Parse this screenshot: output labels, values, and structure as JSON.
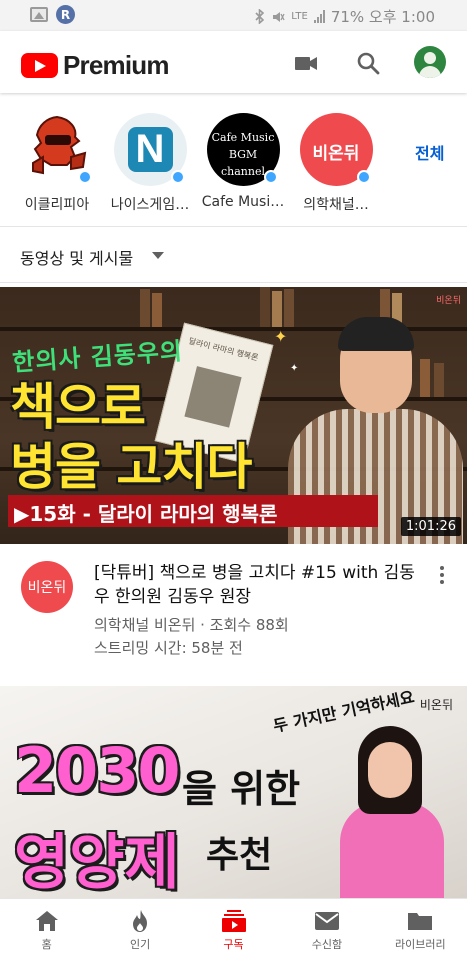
{
  "status_bar": {
    "right_text": "71% 오후 1:00",
    "network": "LTE"
  },
  "header": {
    "logo_text": "Premium"
  },
  "channels": {
    "items": [
      {
        "name": "이클리피아",
        "avatar_bg": "#ffffff"
      },
      {
        "name": "나이스게임…",
        "avatar_bg": "#e9f0f3",
        "avatar_letter": "N"
      },
      {
        "name": "Cafe Musi…",
        "avatar_bg": "#000000",
        "avatar_text": "Cafe Music BGM channel"
      },
      {
        "name": "의학채널…",
        "avatar_bg": "#ef4a4e",
        "avatar_text": "비온뒤"
      }
    ],
    "all_label": "전체"
  },
  "filter": {
    "label": "동영상 및 게시물"
  },
  "videos": [
    {
      "thumb_subtitle": "한의사 김동우의",
      "thumb_line1": "책으로",
      "thumb_line2": "병을 고치다",
      "thumb_bar": "▶15화 - 달라이 라마의 행복론",
      "duration": "1:01:26",
      "channel_avatar_text": "비온뒤",
      "title": "[닥튜버] 책으로 병을 고치다 #15 with 김동우 한의원 김동우 원장",
      "meta_line1": "의학채널 비온뒤 · 조회수 88회",
      "meta_line2": "스트리밍 시간: 58분 전"
    },
    {
      "thumb_note": "두 가지만 기억하세요",
      "thumb_logo": "비온뒤",
      "thumb_big1": "2030",
      "thumb_mid1": "을 위한",
      "thumb_big2": "영양제",
      "thumb_mid2": "추천"
    }
  ],
  "bottom_nav": {
    "items": [
      {
        "label": "홈"
      },
      {
        "label": "인기"
      },
      {
        "label": "구독"
      },
      {
        "label": "수신함"
      },
      {
        "label": "라이브러리"
      }
    ],
    "active": "구독"
  },
  "colors": {
    "brand_red": "#ff0000",
    "link_blue": "#065fd4",
    "notify_dot": "#3ea6ff",
    "active_nav": "#e00000"
  }
}
